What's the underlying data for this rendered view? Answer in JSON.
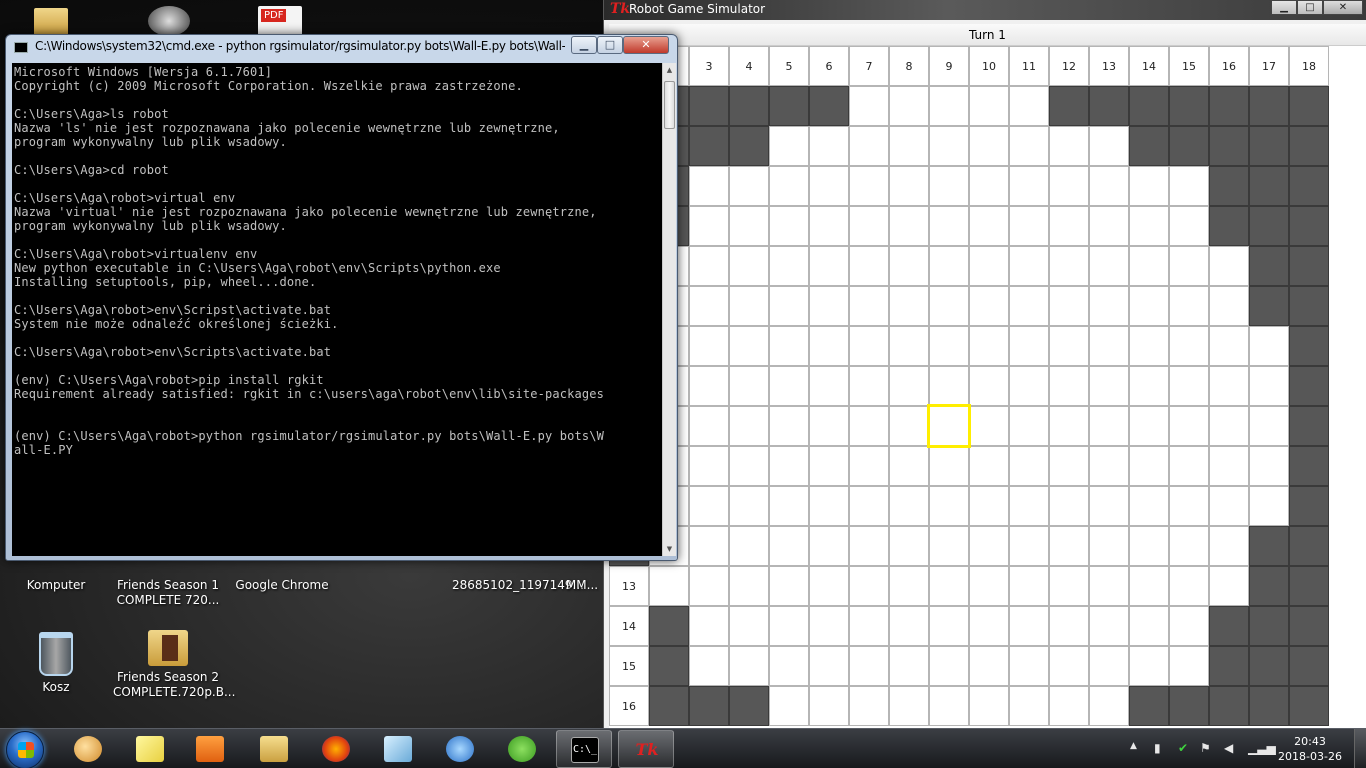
{
  "desktop": {
    "icons_row1": [
      {
        "label_line1": "Komputer",
        "label_line2": ""
      },
      {
        "label_line1": "Friends Season 1",
        "label_line2": "COMPLETE 720..."
      },
      {
        "label_line1": "Google Chrome",
        "label_line2": ""
      },
      {
        "label_line1": "28685102_1197149...",
        "label_line2": ""
      },
      {
        "label_line1": "MM...",
        "label_line2": ""
      }
    ],
    "icons_row2": [
      {
        "label_line1": "Kosz",
        "label_line2": ""
      },
      {
        "label_line1": "Friends Season 2",
        "label_line2": "COMPLETE.720p.B..."
      }
    ],
    "top_icon_pdf_badge": "PDF"
  },
  "cmd": {
    "title": "C:\\Windows\\system32\\cmd.exe - python  rgsimulator/rgsimulator.py bots\\Wall-E.py bots\\Wall-E.PY",
    "minimize": "▁",
    "maximize": "□",
    "close": "✕",
    "lines": [
      "Microsoft Windows [Wersja 6.1.7601]",
      "Copyright (c) 2009 Microsoft Corporation. Wszelkie prawa zastrzeżone.",
      "",
      "C:\\Users\\Aga>ls robot",
      "Nazwa 'ls' nie jest rozpoznawana jako polecenie wewnętrzne lub zewnętrzne,",
      "program wykonywalny lub plik wsadowy.",
      "",
      "C:\\Users\\Aga>cd robot",
      "",
      "C:\\Users\\Aga\\robot>virtual env",
      "Nazwa 'virtual' nie jest rozpoznawana jako polecenie wewnętrzne lub zewnętrzne,",
      "program wykonywalny lub plik wsadowy.",
      "",
      "C:\\Users\\Aga\\robot>virtualenv env",
      "New python executable in C:\\Users\\Aga\\robot\\env\\Scripts\\python.exe",
      "Installing setuptools, pip, wheel...done.",
      "",
      "C:\\Users\\Aga\\robot>env\\Scripst\\activate.bat",
      "System nie może odnaleźć określonej ścieżki.",
      "",
      "C:\\Users\\Aga\\robot>env\\Scripts\\activate.bat",
      "",
      "(env) C:\\Users\\Aga\\robot>pip install rgkit",
      "Requirement already satisfied: rgkit in c:\\users\\aga\\robot\\env\\lib\\site-packages",
      "",
      "",
      "(env) C:\\Users\\Aga\\robot>python rgsimulator/rgsimulator.py bots\\Wall-E.py bots\\W",
      "all-E.PY"
    ]
  },
  "robot_game": {
    "title": "Robot Game Simulator",
    "app_icon": "Tk",
    "minimize": "▁",
    "maximize": "□",
    "close": "✕",
    "turn_label": "Turn 1",
    "column_headers": [
      "2",
      "3",
      "4",
      "5",
      "6",
      "7",
      "8",
      "9",
      "10",
      "11",
      "12",
      "13",
      "14",
      "15",
      "16",
      "17",
      "18"
    ],
    "row_headers": [
      "13",
      "14",
      "15",
      "16"
    ],
    "selected_cell": {
      "col": 9,
      "row": 9
    },
    "open_cells_by_row": [
      {
        "row": 1,
        "open": [
          7,
          8,
          9,
          10,
          11
        ]
      },
      {
        "row": 2,
        "open": [
          5,
          6,
          7,
          8,
          9,
          10,
          11,
          12,
          13
        ]
      },
      {
        "row": 3,
        "open": [
          3,
          4,
          5,
          6,
          7,
          8,
          9,
          10,
          11,
          12,
          13,
          14,
          15
        ]
      },
      {
        "row": 4,
        "open": [
          3,
          4,
          5,
          6,
          7,
          8,
          9,
          10,
          11,
          12,
          13,
          14,
          15
        ]
      },
      {
        "row": 5,
        "open": [
          2,
          3,
          4,
          5,
          6,
          7,
          8,
          9,
          10,
          11,
          12,
          13,
          14,
          15,
          16
        ]
      },
      {
        "row": 6,
        "open": [
          2,
          3,
          4,
          5,
          6,
          7,
          8,
          9,
          10,
          11,
          12,
          13,
          14,
          15,
          16
        ]
      },
      {
        "row": 7,
        "open": [
          2,
          3,
          4,
          5,
          6,
          7,
          8,
          9,
          10,
          11,
          12,
          13,
          14,
          15,
          16,
          17
        ]
      },
      {
        "row": 8,
        "open": [
          2,
          3,
          4,
          5,
          6,
          7,
          8,
          9,
          10,
          11,
          12,
          13,
          14,
          15,
          16,
          17
        ]
      },
      {
        "row": 9,
        "open": [
          2,
          3,
          4,
          5,
          6,
          7,
          8,
          9,
          10,
          11,
          12,
          13,
          14,
          15,
          16,
          17
        ]
      },
      {
        "row": 10,
        "open": [
          2,
          3,
          4,
          5,
          6,
          7,
          8,
          9,
          10,
          11,
          12,
          13,
          14,
          15,
          16,
          17
        ]
      },
      {
        "row": 11,
        "open": [
          2,
          3,
          4,
          5,
          6,
          7,
          8,
          9,
          10,
          11,
          12,
          13,
          14,
          15,
          16,
          17
        ]
      },
      {
        "row": 12,
        "open": [
          2,
          3,
          4,
          5,
          6,
          7,
          8,
          9,
          10,
          11,
          12,
          13,
          14,
          15,
          16
        ]
      },
      {
        "row": 13,
        "open": [
          2,
          3,
          4,
          5,
          6,
          7,
          8,
          9,
          10,
          11,
          12,
          13,
          14,
          15,
          16
        ]
      },
      {
        "row": 14,
        "open": [
          3,
          4,
          5,
          6,
          7,
          8,
          9,
          10,
          11,
          12,
          13,
          14,
          15
        ]
      },
      {
        "row": 15,
        "open": [
          3,
          4,
          5,
          6,
          7,
          8,
          9,
          10,
          11,
          12,
          13,
          14,
          15
        ]
      },
      {
        "row": 16,
        "open": [
          5,
          6,
          7,
          8,
          9,
          10,
          11,
          12,
          13
        ]
      }
    ],
    "colors": {
      "obstacle": "#575757",
      "open": "#ffffff",
      "selection": "#ffee00"
    }
  },
  "taskbar": {
    "pinned": [
      {
        "name": "paint-app",
        "icon": "palette-icon",
        "active": false
      },
      {
        "name": "sticky-notes",
        "icon": "notes-icon",
        "active": false
      },
      {
        "name": "media-player",
        "icon": "play-icon",
        "active": false
      },
      {
        "name": "explorer",
        "icon": "folder-icon",
        "active": false
      },
      {
        "name": "firefox",
        "icon": "firefox-icon",
        "active": false
      },
      {
        "name": "notepad",
        "icon": "notepad-icon",
        "active": false
      },
      {
        "name": "thunderbird",
        "icon": "mail-icon",
        "active": false
      },
      {
        "name": "utorrent",
        "icon": "utorrent-icon",
        "active": false
      },
      {
        "name": "cmd",
        "icon": "cmd-icon",
        "active": true,
        "label": "C:\\_"
      },
      {
        "name": "tk",
        "icon": "tk-icon",
        "active": true,
        "label": "Tk"
      }
    ],
    "tray_chevron": "▲",
    "clock_time": "20:43",
    "clock_date": "2018-03-26"
  }
}
